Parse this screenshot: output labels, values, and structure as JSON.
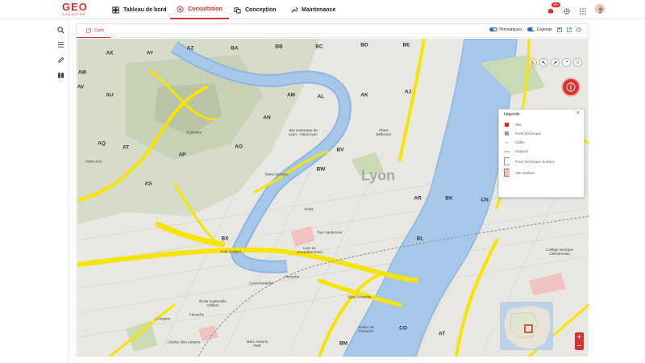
{
  "app": {
    "logo_text": "GEO",
    "logo_sub": "CADASTRE",
    "nav": {
      "dashboard": "Tableau de bord",
      "consultation": "Consultation",
      "conception": "Conception",
      "maintenance": "Maintenance"
    },
    "notif_count": "99+"
  },
  "panel": {
    "tab_label": "Carte",
    "toggle_thematiques": "Thématiques",
    "toggle_legende": "Légende"
  },
  "legend": {
    "title": "Légende",
    "close": "×",
    "items": [
      {
        "label": "Site",
        "icon": "red-square"
      },
      {
        "label": "Point Technique",
        "icon": "gray-square"
      },
      {
        "label": "Câble",
        "icon": "gray-dot"
      },
      {
        "label": "Support",
        "icon": "green-line"
      },
      {
        "label": "Point Technique Surface",
        "icon": "gray-outline-box"
      },
      {
        "label": "Site Surface",
        "icon": "red-hatched-box"
      }
    ]
  },
  "map": {
    "city_label": "Lyon",
    "grid_labels": [
      "AW",
      "AX",
      "AY",
      "AZ",
      "BA",
      "BB",
      "BC",
      "BD",
      "BE",
      "AV",
      "AU",
      "AT",
      "AS",
      "AR",
      "AQ",
      "AP",
      "AO",
      "AN",
      "AM",
      "AL",
      "AK",
      "AJ",
      "BV",
      "BW",
      "BX",
      "BK",
      "BL",
      "BM",
      "CN",
      "CO",
      "AT"
    ],
    "places": {
      "saint_just": "Saint-Just",
      "fourviere": "Fourvière",
      "vieux_lyon": "Site Historique de\nLyon - Vieux Lyon",
      "saint_georges": "Saint-Georges",
      "ainay": "Ainay",
      "lyon2": "Lyon 2e\nArrondissement",
      "perrache": "Perrache",
      "perrache2": "Perrache",
      "lyon_perrache": "Lyon-Perrache",
      "ecole": "École maternelle\nGillibert",
      "ampere": "L'Ampère",
      "creche": "Crèche Sitis Ampère",
      "marc_antoine": "Marc Antoine\nPetit",
      "college": "Collège Georges\nClemenceau",
      "pont_galliéni": "Pont Galliéni",
      "quai_perrache": "Quai Perrache",
      "viaduc": "Viaduc de\nPerrache",
      "rue_vaubecour": "Rue Vaubecour",
      "place_bellecour": "Place\nBellecour"
    },
    "zoom_in": "+",
    "zoom_out": "−"
  }
}
